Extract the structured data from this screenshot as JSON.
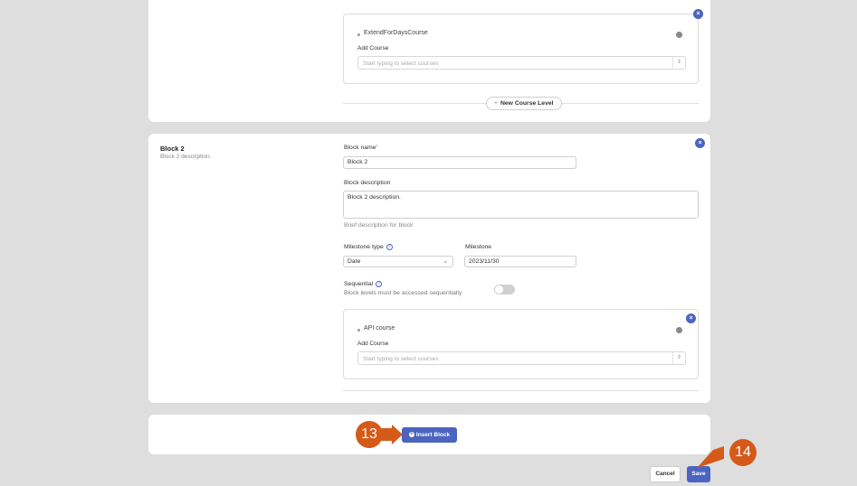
{
  "block1": {
    "level": {
      "course": "ExtendForDaysCourse",
      "add_course_label": "Add Course",
      "add_course_placeholder": "Start typing to select courses"
    },
    "new_level_label": "New Course Level"
  },
  "block2": {
    "title": "Block 2",
    "description": "Block 2 description.",
    "block_name_label": "Block name",
    "block_name_value": "Block 2",
    "block_description_label": "Block description",
    "block_description_value": "Block 2 description.",
    "description_hint": "Brief description for block",
    "milestone_type_label": "Milestone type",
    "milestone_type_value": "Date",
    "milestone_label": "Milestone",
    "milestone_value": "2023/11/30",
    "sequential_label": "Sequential",
    "sequential_hint": "Block levels must be accessed sequentially",
    "level": {
      "course": "API course",
      "add_course_label": "Add Course",
      "add_course_placeholder": "Start typing to select courses"
    }
  },
  "footer": {
    "insert_block_label": "Insert Block",
    "cancel_label": "Cancel",
    "save_label": "Save"
  },
  "callouts": {
    "insert_step": "13",
    "save_step": "14"
  },
  "colors": {
    "accent": "#4a64c0",
    "callout": "#d55a1a",
    "background": "#dedede"
  }
}
